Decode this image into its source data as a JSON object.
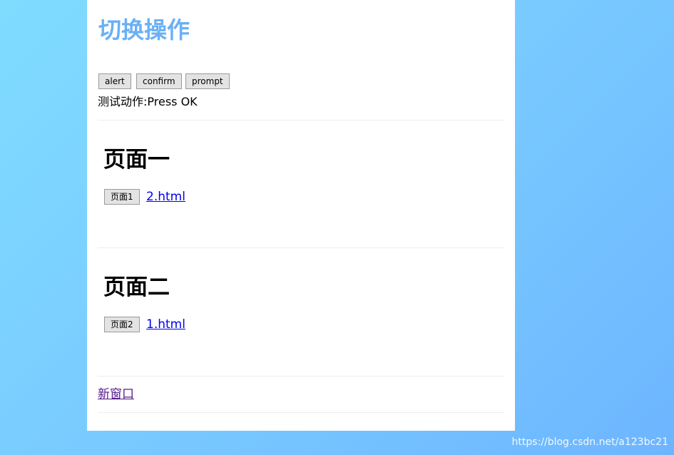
{
  "page": {
    "title": "切换操作"
  },
  "dialog_buttons": {
    "alert": "alert",
    "confirm": "confirm",
    "prompt": "prompt"
  },
  "status": {
    "text": "测试动作:Press OK"
  },
  "section1": {
    "heading": "页面一",
    "button": "页面1",
    "link": "2.html"
  },
  "section2": {
    "heading": "页面二",
    "button": "页面2",
    "link": "1.html"
  },
  "new_window": {
    "link": "新窗口"
  },
  "watermark": {
    "text": "https://blog.csdn.net/a123bc21"
  },
  "colors": {
    "title": "#6ab0f5",
    "link": "#0000ee",
    "visited_link": "#551a8b",
    "background_from": "#7fdcff",
    "background_to": "#6db5ff"
  }
}
